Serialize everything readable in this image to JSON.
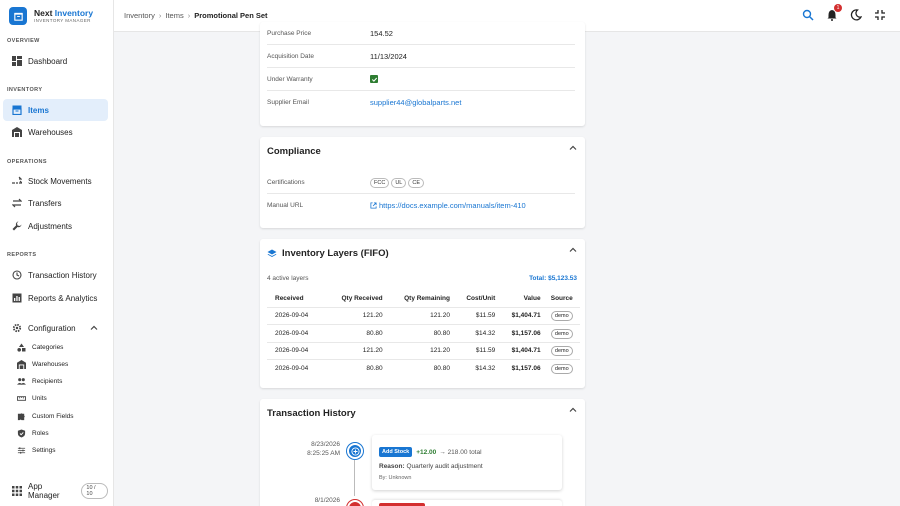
{
  "brand": {
    "name_part1": "Next ",
    "name_part2": "Inventory",
    "subtitle": "INVENTORY MANAGER"
  },
  "sidebar": {
    "sections": {
      "overview": "OVERVIEW",
      "inventory": "INVENTORY",
      "operations": "OPERATIONS",
      "reports": "REPORTS"
    },
    "dashboard": "Dashboard",
    "items": "Items",
    "warehouses": "Warehouses",
    "stock_movements": "Stock Movements",
    "transfers": "Transfers",
    "adjustments": "Adjustments",
    "transaction_history": "Transaction History",
    "reports_analytics": "Reports & Analytics",
    "configuration": "Configuration",
    "config_items": [
      "Categories",
      "Warehouses",
      "Recipients",
      "Units",
      "Custom Fields",
      "Roles",
      "Settings"
    ],
    "app_manager": "App Manager",
    "app_manager_count": "10 / 10"
  },
  "breadcrumb": {
    "level1": "Inventory",
    "level2": "Items",
    "current": "Promotional Pen Set"
  },
  "notifications": {
    "count": "1"
  },
  "details": {
    "purchase_price_label": "Purchase Price",
    "purchase_price": "154.52",
    "acquisition_date_label": "Acquisition Date",
    "acquisition_date": "11/13/2024",
    "warranty_label": "Under Warranty",
    "supplier_email_label": "Supplier Email",
    "supplier_email": "supplier44@globalparts.net"
  },
  "compliance": {
    "title": "Compliance",
    "certifications_label": "Certifications",
    "certifications": [
      "FCC",
      "UL",
      "CE"
    ],
    "manual_label": "Manual URL",
    "manual_url": "https://docs.example.com/manuals/item-410"
  },
  "layers": {
    "title": "Inventory Layers (FIFO)",
    "active": "4 active layers",
    "total": "Total: $5,123.53",
    "headers": [
      "Received",
      "Qty Received",
      "Qty Remaining",
      "Cost/Unit",
      "Value",
      "Source"
    ],
    "rows": [
      [
        "2026-09-04",
        "121.20",
        "121.20",
        "$11.59",
        "$1,404.71",
        "demo"
      ],
      [
        "2026-09-04",
        "80.80",
        "80.80",
        "$14.32",
        "$1,157.06",
        "demo"
      ],
      [
        "2026-09-04",
        "121.20",
        "121.20",
        "$11.59",
        "$1,404.71",
        "demo"
      ],
      [
        "2026-09-04",
        "80.80",
        "80.80",
        "$14.32",
        "$1,157.06",
        "demo"
      ]
    ]
  },
  "history": {
    "title": "Transaction History",
    "entries": [
      {
        "date": "8/23/2026",
        "time": "8:25:25 AM",
        "tag": "Add Stock",
        "delta": "+12.00",
        "arrow_total": "→ 218.00 total",
        "reason_label": "Reason:",
        "reason": "Quarterly audit adjustment",
        "by": "By: Unknown"
      },
      {
        "date": "8/1/2026"
      }
    ]
  },
  "colors": {
    "accent": "#1976d2",
    "success": "#2e7d32",
    "danger": "#d32f2f"
  }
}
